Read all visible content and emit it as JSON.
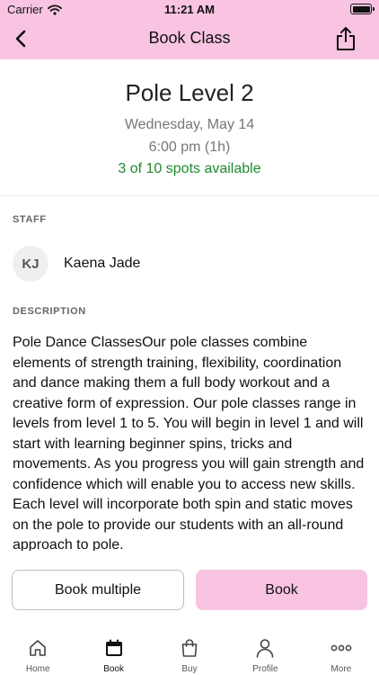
{
  "status_bar": {
    "carrier": "Carrier",
    "time": "11:21 AM"
  },
  "nav": {
    "title": "Book Class",
    "back_icon": "chevron-left-icon",
    "share_icon": "share-icon"
  },
  "class_info": {
    "name": "Pole Level 2",
    "date": "Wednesday, May 14",
    "time": "6:00 pm (1h)",
    "spots": "3 of 10 spots available",
    "spots_color": "#1f8a2e"
  },
  "staff": {
    "label": "STAFF",
    "initials": "KJ",
    "name": "Kaena Jade"
  },
  "description": {
    "label": "DESCRIPTION",
    "text": "Pole Dance ClassesOur pole classes combine elements of strength training, flexibility, coordination and dance making them a full body workout and a creative form of expression. Our pole classes range in levels from level 1 to 5. You will begin in level 1 and will start with learning beginner spins, tricks and movements. As you progress you will gain strength and confidence which will enable you to access new skills. Each level will incorporate both spin and static moves on the pole to provide our students with an all-round approach to pole."
  },
  "actions": {
    "book_multiple": "Book multiple",
    "book": "Book"
  },
  "tabs": [
    {
      "label": "Home",
      "icon": "home-icon"
    },
    {
      "label": "Book",
      "icon": "calendar-icon"
    },
    {
      "label": "Buy",
      "icon": "shopping-bag-icon"
    },
    {
      "label": "Profile",
      "icon": "person-icon"
    },
    {
      "label": "More",
      "icon": "more-icon"
    }
  ],
  "colors": {
    "brand": "#f8c4e1",
    "active_tab": "#111111"
  }
}
